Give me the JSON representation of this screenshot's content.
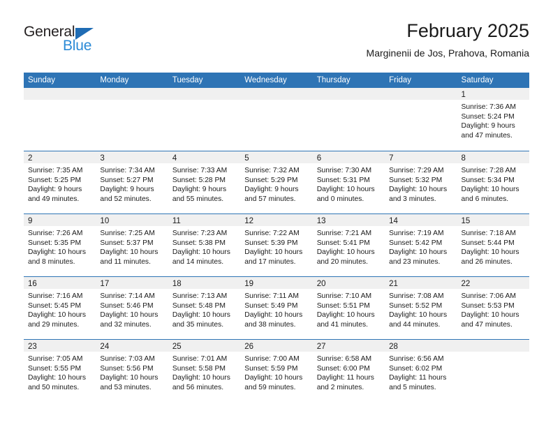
{
  "brand": {
    "name_part1": "General",
    "name_part2": "Blue",
    "triangle_color": "#1f6cb4",
    "blue_color": "#2b8ad6"
  },
  "header": {
    "month_title": "February 2025",
    "location": "Marginenii de Jos, Prahova, Romania"
  },
  "theme": {
    "header_blue": "#2e74b5",
    "day_band_gray": "#f0f0f0",
    "text_color": "#1a1a1a"
  },
  "weekdays": [
    "Sunday",
    "Monday",
    "Tuesday",
    "Wednesday",
    "Thursday",
    "Friday",
    "Saturday"
  ],
  "weeks": [
    [
      {
        "day": "",
        "sunrise": "",
        "sunset": "",
        "daylight1": "",
        "daylight2": ""
      },
      {
        "day": "",
        "sunrise": "",
        "sunset": "",
        "daylight1": "",
        "daylight2": ""
      },
      {
        "day": "",
        "sunrise": "",
        "sunset": "",
        "daylight1": "",
        "daylight2": ""
      },
      {
        "day": "",
        "sunrise": "",
        "sunset": "",
        "daylight1": "",
        "daylight2": ""
      },
      {
        "day": "",
        "sunrise": "",
        "sunset": "",
        "daylight1": "",
        "daylight2": ""
      },
      {
        "day": "",
        "sunrise": "",
        "sunset": "",
        "daylight1": "",
        "daylight2": ""
      },
      {
        "day": "1",
        "sunrise": "Sunrise: 7:36 AM",
        "sunset": "Sunset: 5:24 PM",
        "daylight1": "Daylight: 9 hours",
        "daylight2": "and 47 minutes."
      }
    ],
    [
      {
        "day": "2",
        "sunrise": "Sunrise: 7:35 AM",
        "sunset": "Sunset: 5:25 PM",
        "daylight1": "Daylight: 9 hours",
        "daylight2": "and 49 minutes."
      },
      {
        "day": "3",
        "sunrise": "Sunrise: 7:34 AM",
        "sunset": "Sunset: 5:27 PM",
        "daylight1": "Daylight: 9 hours",
        "daylight2": "and 52 minutes."
      },
      {
        "day": "4",
        "sunrise": "Sunrise: 7:33 AM",
        "sunset": "Sunset: 5:28 PM",
        "daylight1": "Daylight: 9 hours",
        "daylight2": "and 55 minutes."
      },
      {
        "day": "5",
        "sunrise": "Sunrise: 7:32 AM",
        "sunset": "Sunset: 5:29 PM",
        "daylight1": "Daylight: 9 hours",
        "daylight2": "and 57 minutes."
      },
      {
        "day": "6",
        "sunrise": "Sunrise: 7:30 AM",
        "sunset": "Sunset: 5:31 PM",
        "daylight1": "Daylight: 10 hours",
        "daylight2": "and 0 minutes."
      },
      {
        "day": "7",
        "sunrise": "Sunrise: 7:29 AM",
        "sunset": "Sunset: 5:32 PM",
        "daylight1": "Daylight: 10 hours",
        "daylight2": "and 3 minutes."
      },
      {
        "day": "8",
        "sunrise": "Sunrise: 7:28 AM",
        "sunset": "Sunset: 5:34 PM",
        "daylight1": "Daylight: 10 hours",
        "daylight2": "and 6 minutes."
      }
    ],
    [
      {
        "day": "9",
        "sunrise": "Sunrise: 7:26 AM",
        "sunset": "Sunset: 5:35 PM",
        "daylight1": "Daylight: 10 hours",
        "daylight2": "and 8 minutes."
      },
      {
        "day": "10",
        "sunrise": "Sunrise: 7:25 AM",
        "sunset": "Sunset: 5:37 PM",
        "daylight1": "Daylight: 10 hours",
        "daylight2": "and 11 minutes."
      },
      {
        "day": "11",
        "sunrise": "Sunrise: 7:23 AM",
        "sunset": "Sunset: 5:38 PM",
        "daylight1": "Daylight: 10 hours",
        "daylight2": "and 14 minutes."
      },
      {
        "day": "12",
        "sunrise": "Sunrise: 7:22 AM",
        "sunset": "Sunset: 5:39 PM",
        "daylight1": "Daylight: 10 hours",
        "daylight2": "and 17 minutes."
      },
      {
        "day": "13",
        "sunrise": "Sunrise: 7:21 AM",
        "sunset": "Sunset: 5:41 PM",
        "daylight1": "Daylight: 10 hours",
        "daylight2": "and 20 minutes."
      },
      {
        "day": "14",
        "sunrise": "Sunrise: 7:19 AM",
        "sunset": "Sunset: 5:42 PM",
        "daylight1": "Daylight: 10 hours",
        "daylight2": "and 23 minutes."
      },
      {
        "day": "15",
        "sunrise": "Sunrise: 7:18 AM",
        "sunset": "Sunset: 5:44 PM",
        "daylight1": "Daylight: 10 hours",
        "daylight2": "and 26 minutes."
      }
    ],
    [
      {
        "day": "16",
        "sunrise": "Sunrise: 7:16 AM",
        "sunset": "Sunset: 5:45 PM",
        "daylight1": "Daylight: 10 hours",
        "daylight2": "and 29 minutes."
      },
      {
        "day": "17",
        "sunrise": "Sunrise: 7:14 AM",
        "sunset": "Sunset: 5:46 PM",
        "daylight1": "Daylight: 10 hours",
        "daylight2": "and 32 minutes."
      },
      {
        "day": "18",
        "sunrise": "Sunrise: 7:13 AM",
        "sunset": "Sunset: 5:48 PM",
        "daylight1": "Daylight: 10 hours",
        "daylight2": "and 35 minutes."
      },
      {
        "day": "19",
        "sunrise": "Sunrise: 7:11 AM",
        "sunset": "Sunset: 5:49 PM",
        "daylight1": "Daylight: 10 hours",
        "daylight2": "and 38 minutes."
      },
      {
        "day": "20",
        "sunrise": "Sunrise: 7:10 AM",
        "sunset": "Sunset: 5:51 PM",
        "daylight1": "Daylight: 10 hours",
        "daylight2": "and 41 minutes."
      },
      {
        "day": "21",
        "sunrise": "Sunrise: 7:08 AM",
        "sunset": "Sunset: 5:52 PM",
        "daylight1": "Daylight: 10 hours",
        "daylight2": "and 44 minutes."
      },
      {
        "day": "22",
        "sunrise": "Sunrise: 7:06 AM",
        "sunset": "Sunset: 5:53 PM",
        "daylight1": "Daylight: 10 hours",
        "daylight2": "and 47 minutes."
      }
    ],
    [
      {
        "day": "23",
        "sunrise": "Sunrise: 7:05 AM",
        "sunset": "Sunset: 5:55 PM",
        "daylight1": "Daylight: 10 hours",
        "daylight2": "and 50 minutes."
      },
      {
        "day": "24",
        "sunrise": "Sunrise: 7:03 AM",
        "sunset": "Sunset: 5:56 PM",
        "daylight1": "Daylight: 10 hours",
        "daylight2": "and 53 minutes."
      },
      {
        "day": "25",
        "sunrise": "Sunrise: 7:01 AM",
        "sunset": "Sunset: 5:58 PM",
        "daylight1": "Daylight: 10 hours",
        "daylight2": "and 56 minutes."
      },
      {
        "day": "26",
        "sunrise": "Sunrise: 7:00 AM",
        "sunset": "Sunset: 5:59 PM",
        "daylight1": "Daylight: 10 hours",
        "daylight2": "and 59 minutes."
      },
      {
        "day": "27",
        "sunrise": "Sunrise: 6:58 AM",
        "sunset": "Sunset: 6:00 PM",
        "daylight1": "Daylight: 11 hours",
        "daylight2": "and 2 minutes."
      },
      {
        "day": "28",
        "sunrise": "Sunrise: 6:56 AM",
        "sunset": "Sunset: 6:02 PM",
        "daylight1": "Daylight: 11 hours",
        "daylight2": "and 5 minutes."
      },
      {
        "day": "",
        "sunrise": "",
        "sunset": "",
        "daylight1": "",
        "daylight2": ""
      }
    ]
  ]
}
